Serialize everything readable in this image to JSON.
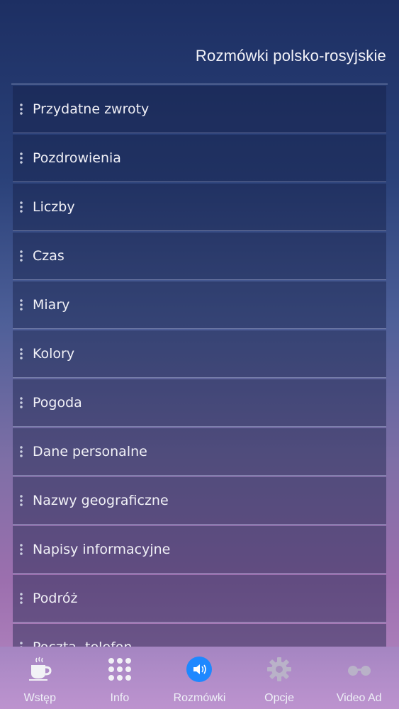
{
  "header": {
    "title": "Rozmówki polsko-rosyjskie"
  },
  "list": {
    "items": [
      "Przydatne zwroty",
      "Pozdrowienia",
      "Liczby",
      "Czas",
      "Miary",
      "Kolory",
      "Pogoda",
      "Dane personalne",
      "Nazwy geograficzne",
      "Napisy informacyjne",
      "Podróż",
      "Poczta, telefon"
    ]
  },
  "tabbar": {
    "tabs": [
      {
        "label": "Wstęp",
        "icon": "coffee-cup-icon"
      },
      {
        "label": "Info",
        "icon": "grid-dots-icon"
      },
      {
        "label": "Rozmówki",
        "icon": "speaker-icon",
        "active": true
      },
      {
        "label": "Opcje",
        "icon": "gear-icon"
      },
      {
        "label": "Video Ad",
        "icon": "glasses-icon"
      }
    ],
    "active_color": "#1e88ff"
  }
}
